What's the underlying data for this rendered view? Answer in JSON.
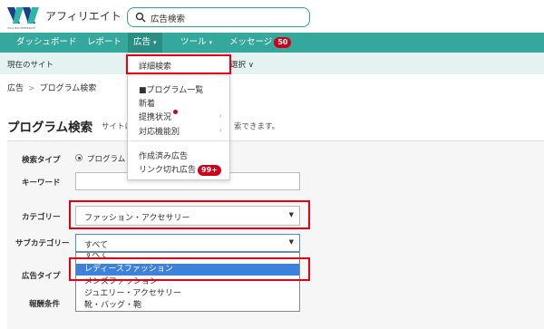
{
  "header": {
    "logo_sub": "VALUECOMMERCE",
    "brand": "アフィリエイト",
    "search_placeholder": "広告検索"
  },
  "nav": {
    "items": [
      {
        "label": "ダッシュボード"
      },
      {
        "label": "レポート"
      },
      {
        "label": "広告",
        "caret": "▾"
      },
      {
        "label": "ツール",
        "caret": "▾"
      },
      {
        "label": "メッセージ",
        "badge": "50"
      }
    ]
  },
  "subbar": {
    "current_site": "現在のサイト",
    "select_label": "選択 ∨"
  },
  "breadcrumb": {
    "root": "広告",
    "sep": ">",
    "current": "プログラム検索"
  },
  "page": {
    "title": "プログラム検索",
    "desc_left": "サイトに",
    "desc_right": "索できます。"
  },
  "form": {
    "search_type_label": "検索タイプ",
    "search_type_value": "プログラム",
    "keyword_label": "キーワード",
    "category_label": "カテゴリー",
    "category_value": "ファッション・アクセサリー",
    "subcategory_label": "サブカテゴリー",
    "subcategory_value": "すべて",
    "ad_type_label": "広告タイプ",
    "reward_label": "報酬条件",
    "subcategory_options": [
      "すべて",
      "レディースファッション",
      "メンズファッション",
      "ジュエリー・アクセサリー",
      "靴・バッグ・鞄"
    ],
    "selected_option": "レディースファッション"
  },
  "menu": {
    "items": [
      {
        "label": "詳細検索"
      },
      {
        "label": "■プログラム一覧"
      },
      {
        "label": "新着"
      },
      {
        "label": "提携状況"
      },
      {
        "label": "対応機能別"
      },
      {
        "label": "作成済み広告"
      },
      {
        "label": "リンク切れ広告",
        "badge": "99+"
      }
    ]
  },
  "colors": {
    "teal": "#34a89c",
    "highlight_red": "#e60012",
    "badge_red": "#d0021b",
    "select_blue": "#3c82dc"
  },
  "icons": {
    "search": "search-icon",
    "logo": "logo-mark-icon"
  }
}
